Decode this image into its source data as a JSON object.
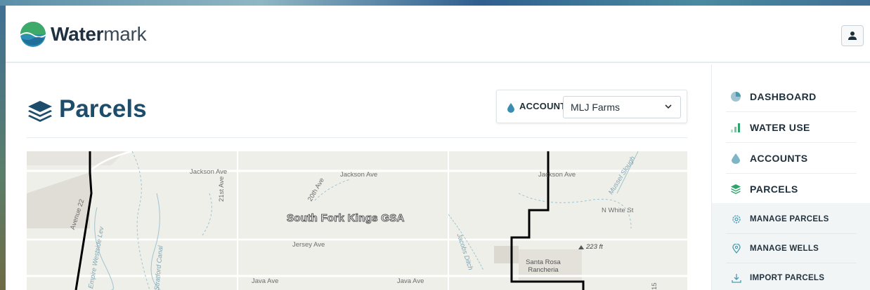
{
  "brand": {
    "name_bold": "Water",
    "name_regular": "mark"
  },
  "header": {
    "user_icon": "user-icon"
  },
  "page": {
    "title": "Parcels",
    "title_icon": "layers-icon"
  },
  "account": {
    "label": "ACCOUNT",
    "selected": "MLJ Farms",
    "icon": "droplet-icon"
  },
  "map": {
    "region_label": "South Fork Kings GSA",
    "roads": [
      "Jackson Ave",
      "Jackson Ave",
      "Jackson Ave",
      "21st Ave",
      "20th Ave",
      "Jersey Ave",
      "Java Ave",
      "Java Ave",
      "N White St"
    ],
    "waterways": [
      "Jacobs Ditch",
      "Empire Westside Lev",
      "Stratford Canal",
      "Mussel Slough"
    ],
    "place": "Santa Rosa Rancheria",
    "elevation": "223 ft",
    "edge_labels": [
      "Avenue 22",
      "15"
    ]
  },
  "sidebar": {
    "items": [
      {
        "label": "DASHBOARD",
        "icon": "pie-chart-icon"
      },
      {
        "label": "WATER USE",
        "icon": "bar-chart-icon"
      },
      {
        "label": "ACCOUNTS",
        "icon": "droplet-icon"
      },
      {
        "label": "PARCELS",
        "icon": "layers-icon"
      }
    ],
    "sub_items": [
      {
        "label": "MANAGE PARCELS",
        "icon": "gear-icon"
      },
      {
        "label": "MANAGE WELLS",
        "icon": "map-pin-icon"
      },
      {
        "label": "IMPORT PARCELS",
        "icon": "download-icon"
      }
    ]
  },
  "colors": {
    "brand_navy": "#1e4d6b",
    "accent_green": "#2fa36b",
    "accent_teal": "#4b9ab0"
  }
}
